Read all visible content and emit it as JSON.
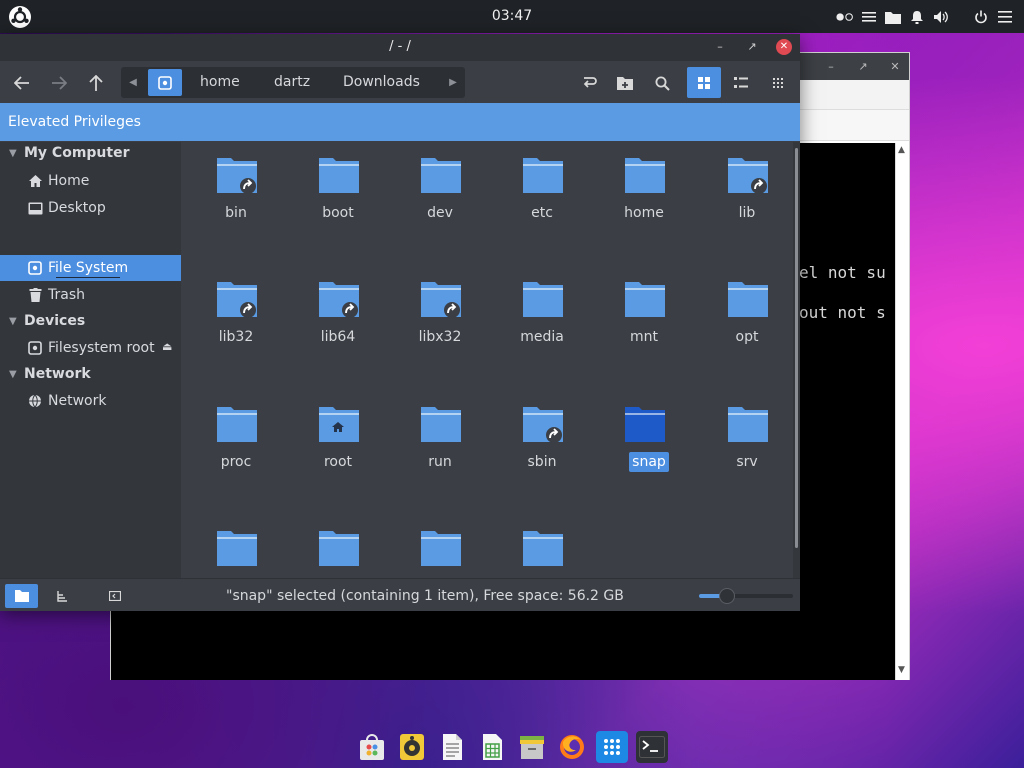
{
  "top_panel": {
    "clock": "03:47",
    "tray": [
      "record-indicator-icon",
      "menu-icon",
      "folder-icon",
      "notifications-icon",
      "volume-icon",
      "power-icon",
      "settings-menu-icon"
    ]
  },
  "terminal": {
    "lines": [
      "el not su",
      "out not s"
    ]
  },
  "file_manager": {
    "title": "/ - /",
    "breadcrumbs": [
      "home",
      "dartz",
      "Downloads"
    ],
    "banner": "Elevated Privileges",
    "sidebar": {
      "sections": [
        {
          "label": "My Computer",
          "items": [
            {
              "label": "Home",
              "icon": "home-icon"
            },
            {
              "label": "Desktop",
              "icon": "desktop-icon"
            },
            {
              "label": "File System",
              "icon": "drive-icon",
              "selected": true
            },
            {
              "label": "Trash",
              "icon": "trash-icon"
            }
          ]
        },
        {
          "label": "Devices",
          "items": [
            {
              "label": "Filesystem root",
              "icon": "drive-icon",
              "eject": true
            }
          ]
        },
        {
          "label": "Network",
          "items": [
            {
              "label": "Network",
              "icon": "network-icon"
            }
          ]
        }
      ]
    },
    "items": [
      {
        "name": "bin",
        "link": true
      },
      {
        "name": "boot"
      },
      {
        "name": "dev"
      },
      {
        "name": "etc"
      },
      {
        "name": "home"
      },
      {
        "name": "lib",
        "link": true
      },
      {
        "name": "lib32",
        "link": true
      },
      {
        "name": "lib64",
        "link": true
      },
      {
        "name": "libx32",
        "link": true
      },
      {
        "name": "media"
      },
      {
        "name": "mnt"
      },
      {
        "name": "opt"
      },
      {
        "name": "proc"
      },
      {
        "name": "root",
        "home_badge": true
      },
      {
        "name": "run"
      },
      {
        "name": "sbin",
        "link": true
      },
      {
        "name": "snap",
        "selected": true
      },
      {
        "name": "srv"
      },
      {
        "name": ""
      },
      {
        "name": ""
      },
      {
        "name": ""
      },
      {
        "name": ""
      }
    ],
    "status": "\"snap\" selected (containing 1 item), Free space: 56.2 GB",
    "zoom_level": 0.3
  },
  "dock": [
    "software-center-icon",
    "music-player-icon",
    "text-editor-icon",
    "spreadsheet-icon",
    "archive-manager-icon",
    "firefox-icon",
    "app-grid-icon",
    "terminal-icon"
  ],
  "colors": {
    "accent": "#4c8fe0",
    "folder": "#5a9be3",
    "folder_selected": "#1e5bc8",
    "panel": "#1f2226",
    "window_bg": "#3b3f45"
  }
}
